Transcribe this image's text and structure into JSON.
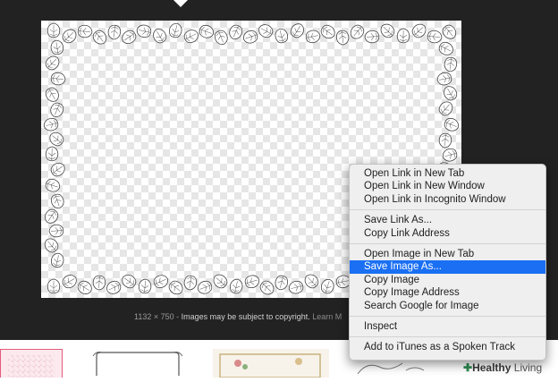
{
  "caption": {
    "dimensions": "1132 × 750",
    "separator": "-",
    "notice": "Images may be subject to copyright.",
    "link": "Learn M"
  },
  "context_menu": {
    "group1": [
      "Open Link in New Tab",
      "Open Link in New Window",
      "Open Link in Incognito Window"
    ],
    "group2": [
      "Save Link As...",
      "Copy Link Address"
    ],
    "group3": [
      "Open Image in New Tab",
      "Save Image As...",
      "Copy Image",
      "Copy Image Address",
      "Search Google for Image"
    ],
    "group4": [
      "Inspect"
    ],
    "group5": [
      "Add to iTunes as a Spoken Track"
    ],
    "highlighted": "Save Image As..."
  },
  "badge": {
    "icon": "plus-icon",
    "bold": "Healthy",
    "rest": "Living"
  },
  "colors": {
    "viewer_bg": "#222222",
    "highlight": "#1a6ff3",
    "badge_green": "#2f8d52"
  }
}
